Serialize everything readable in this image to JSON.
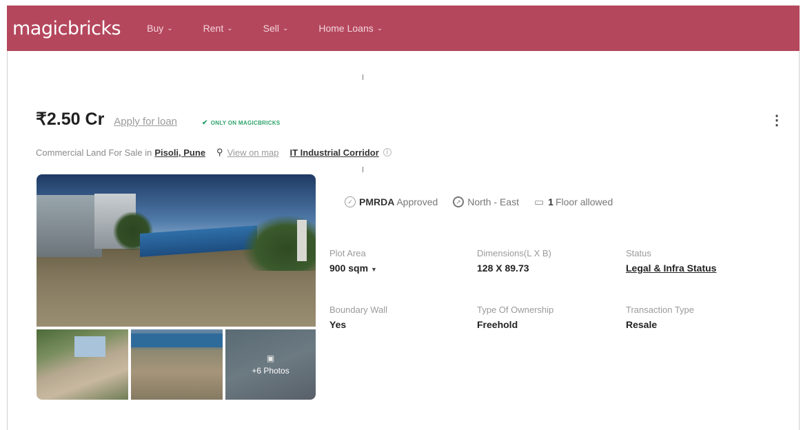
{
  "header": {
    "logo": "magicbricks",
    "nav": [
      {
        "label": "Buy"
      },
      {
        "label": "Rent"
      },
      {
        "label": "Sell"
      },
      {
        "label": "Home Loans"
      }
    ]
  },
  "listing": {
    "price": "₹2.50 Cr",
    "loan_link": "Apply for loan",
    "badge": "ONLY ON MAGICBRICKS",
    "subtitle_prefix": "Commercial Land For Sale in",
    "location": "Pisoli, Pune",
    "map_link": "View on map",
    "corridor": "IT Industrial Corridor",
    "photos_more": "+6 Photos"
  },
  "highlights": {
    "authority": "PMRDA",
    "authority_suffix": "Approved",
    "facing": "North - East",
    "floors_count": "1",
    "floors_suffix": "Floor allowed"
  },
  "specs": {
    "plot_area_label": "Plot Area",
    "plot_area_value": "900 sqm",
    "dimensions_label": "Dimensions(L X B)",
    "dimensions_value": "128 X 89.73",
    "status_label": "Status",
    "status_value": "Legal & Infra Status",
    "boundary_label": "Boundary Wall",
    "boundary_value": "Yes",
    "ownership_label": "Type Of Ownership",
    "ownership_value": "Freehold",
    "transaction_label": "Transaction Type",
    "transaction_value": "Resale"
  },
  "colors": {
    "brand": "#b5475d",
    "badge_green": "#2ea36b"
  }
}
